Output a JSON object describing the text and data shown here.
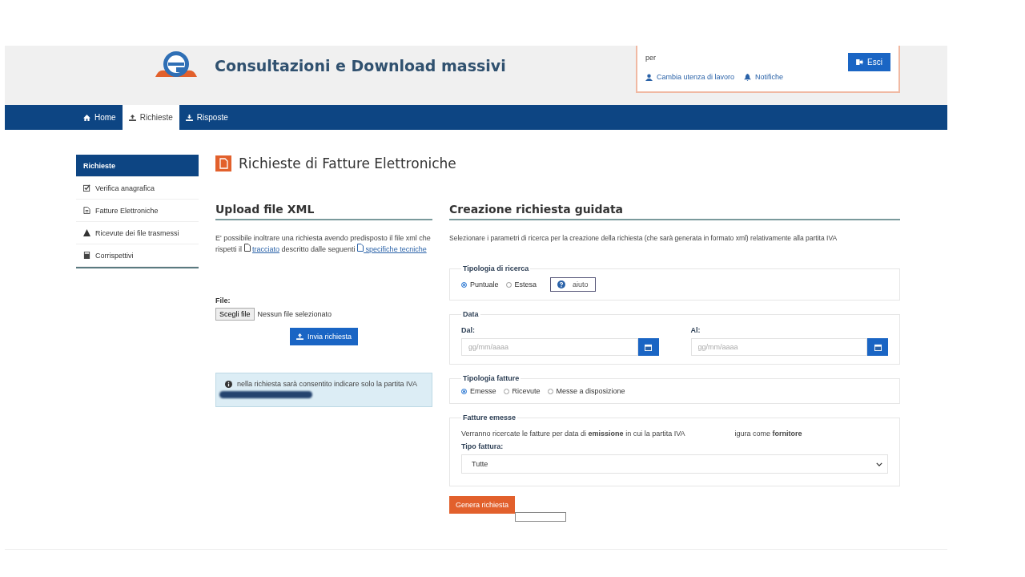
{
  "header": {
    "title": "Consultazioni e Download massivi",
    "user_box": {
      "line": "per",
      "links": [
        "Cambia utenza di lavoro",
        "Notifiche"
      ],
      "logout": "Esci"
    }
  },
  "nav": [
    {
      "label": "Home",
      "selected": false
    },
    {
      "label": "Richieste",
      "selected": true
    },
    {
      "label": "Risposte",
      "selected": false
    }
  ],
  "sidebar": {
    "items": [
      {
        "label": "Richieste",
        "selected": true
      },
      {
        "label": "Verifica anagrafica",
        "selected": false
      },
      {
        "label": "Fatture Elettroniche",
        "selected": false
      },
      {
        "label": "Ricevute dei file trasmessi",
        "selected": false
      },
      {
        "label": "Corrispettivi",
        "selected": false
      }
    ]
  },
  "page_title": "Richieste di Fatture Elettroniche",
  "upload": {
    "heading": "Upload file XML",
    "text_before": "E' possibile inoltrare una richiesta avendo predisposto il file xml che rispetti il",
    "link1": "tracciato",
    "text_after": "descritto dalle seguenti",
    "link2": "specifiche tecniche",
    "file_label": "File:",
    "choose_button": "Scegli file",
    "no_file": "Nessun file selezionato",
    "submit": "Invia richiesta",
    "info": "nella richiesta sarà consentito indicare solo la partita IVA"
  },
  "guided": {
    "heading": "Creazione richiesta guidata",
    "intro": "Selezionare i parametri di ricerca per la creazione della richiesta (che sarà generata in formato xml) relativamente alla partita IVA",
    "search_type": {
      "legend": "Tipologia di ricerca",
      "options": [
        {
          "label": "Puntuale",
          "selected": true
        },
        {
          "label": "Estesa",
          "selected": false
        }
      ],
      "help": "aiuto"
    },
    "date": {
      "legend": "Data",
      "from_label": "Dal:",
      "from_placeholder": "gg/mm/aaaa",
      "to_label": "Al:",
      "to_placeholder": "gg/mm/aaaa"
    },
    "invoice_type": {
      "legend": "Tipologia fatture",
      "options": [
        {
          "label": "Emesse",
          "selected": true
        },
        {
          "label": "Ricevute",
          "selected": false
        },
        {
          "label": "Messe a disposizione",
          "selected": false
        }
      ]
    },
    "issued": {
      "legend": "Fatture emesse",
      "note_start": "Verranno ricercate le fatture per data di **emissione** in cui la partita IVA",
      "note_end": "igura come **fornitore**",
      "type_label": "Tipo fattura:",
      "type_value": "Tutte"
    },
    "generate": "Genera richiesta"
  }
}
